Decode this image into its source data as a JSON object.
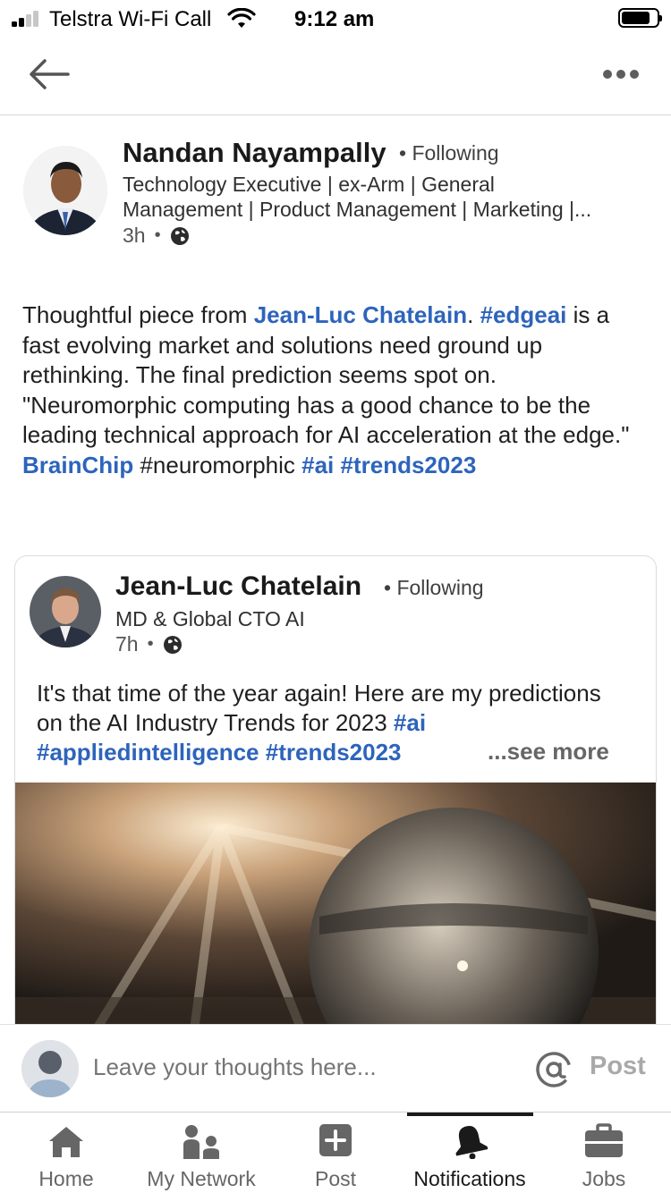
{
  "status_bar": {
    "carrier": "Telstra Wi-Fi Call",
    "time": "9:12 am"
  },
  "top_nav": {
    "back_icon": "arrow-left-icon",
    "more_icon": "ellipsis-icon"
  },
  "post": {
    "author": {
      "name": "Nandan Nayampally",
      "follow_status": "• Following",
      "headline_line1": "Technology Executive | ex-Arm | General",
      "headline_line2": "Management | Product Management | Marketing |...",
      "time": "3h",
      "visibility_icon": "globe-icon"
    },
    "text": {
      "p1_a": "Thoughtful piece from ",
      "p1_link": "Jean-Luc Chatelain",
      "p1_b": ".  ",
      "p1_tag": "#edgeai",
      "p1_c": " is a fast evolving market and solutions need ground up rethinking. The final prediction seems spot on. \"Neuromorphic computing has a good chance to be the leading technical approach for AI acceleration at the edge.\"",
      "l2_link": "BrainChip",
      "l2_plain": " #neuromorphic ",
      "l2_tag1": "#ai",
      "l2_tag2": "#trends2023"
    }
  },
  "shared": {
    "name": "Jean-Luc Chatelain",
    "follow_status": "• Following",
    "headline": "MD & Global CTO AI",
    "time": "7h",
    "visibility_icon": "globe-icon",
    "text_a": "It's that time of the year again! Here are my predictions on the AI Industry Trends for 2023 ",
    "tag1": "#ai",
    "tag2": "#appliedintelligence",
    "tag3": "#trends2023",
    "see_more": "...see more"
  },
  "comment_bar": {
    "placeholder": "Leave your thoughts here...",
    "mention_icon": "at-sign-icon",
    "post_label": "Post"
  },
  "bottom_nav": {
    "items": [
      {
        "label": "Home",
        "icon": "home-icon"
      },
      {
        "label": "My Network",
        "icon": "network-icon"
      },
      {
        "label": "Post",
        "icon": "plus-square-icon"
      },
      {
        "label": "Notifications",
        "icon": "bell-icon",
        "active": true
      },
      {
        "label": "Jobs",
        "icon": "briefcase-icon"
      }
    ]
  },
  "colors": {
    "link": "#2d64bc",
    "nav_icon": "#666666",
    "active": "#1a1a1a"
  }
}
